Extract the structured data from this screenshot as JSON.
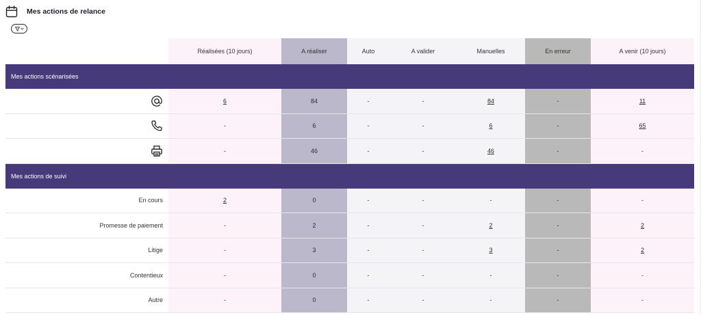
{
  "header": {
    "title": "Mes actions de relance",
    "icon": "calendar-icon"
  },
  "filter": {
    "icon": "filter-icon",
    "dropdown_icon": "chevron-down-icon"
  },
  "columns": [
    "Réalisées (10 jours)",
    "A réaliser",
    "Auto",
    "A valider",
    "Manuelles",
    "En erreur",
    "A venir (10 jours)"
  ],
  "colors": {
    "section_bg": "#463a7a",
    "col_pink": "#fdf2f7",
    "col_lavender": "#bcb8cb",
    "col_gray": "#f4f4f6",
    "col_dark": "#b9b9b9"
  },
  "sections": [
    {
      "title": "Mes actions scénarisées",
      "rows": [
        {
          "icon": "email-icon",
          "cells": [
            "6",
            "84",
            "-",
            "-",
            "84",
            "-",
            "11"
          ]
        },
        {
          "icon": "phone-icon",
          "cells": [
            "-",
            "6",
            "-",
            "-",
            "6",
            "-",
            "65"
          ]
        },
        {
          "icon": "printer-icon",
          "cells": [
            "-",
            "46",
            "-",
            "-",
            "46",
            "-",
            "-"
          ]
        }
      ]
    },
    {
      "title": "Mes actions de suivi",
      "rows": [
        {
          "label": "En cours",
          "cells": [
            "2",
            "0",
            "-",
            "-",
            "-",
            "-",
            "-"
          ]
        },
        {
          "label": "Promesse de paiement",
          "cells": [
            "-",
            "2",
            "-",
            "-",
            "2",
            "-",
            "2"
          ]
        },
        {
          "label": "Litige",
          "cells": [
            "-",
            "3",
            "-",
            "-",
            "3",
            "-",
            "2"
          ]
        },
        {
          "label": "Contentieux",
          "cells": [
            "-",
            "0",
            "-",
            "-",
            "-",
            "-",
            "-"
          ]
        },
        {
          "label": "Autre",
          "cells": [
            "-",
            "0",
            "-",
            "-",
            "-",
            "-",
            "-"
          ]
        }
      ]
    }
  ]
}
